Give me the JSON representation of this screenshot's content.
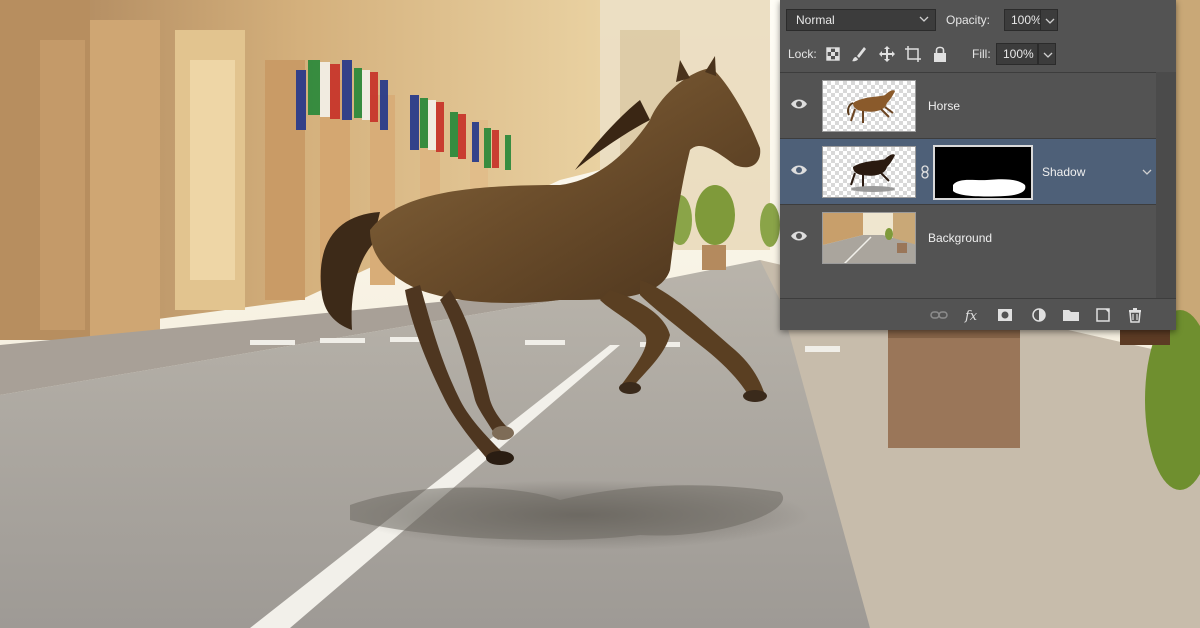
{
  "layers_panel": {
    "blend_mode": "Normal",
    "opacity_label": "Opacity:",
    "opacity_value": "100%",
    "lock_label": "Lock:",
    "fill_label": "Fill:",
    "fill_value": "100%",
    "layers": [
      {
        "name": "Horse",
        "selected": false
      },
      {
        "name": "Shadow",
        "selected": true
      },
      {
        "name": "Background",
        "selected": false
      }
    ],
    "bottom_icons": [
      "link-icon",
      "fx-icon",
      "mask-icon",
      "adjustment-icon",
      "folder-icon",
      "new-layer-icon",
      "trash-icon"
    ]
  },
  "colors": {
    "panel_bg": "#535353",
    "selected_layer": "#4e6078",
    "field_bg": "#3c3c3c"
  }
}
